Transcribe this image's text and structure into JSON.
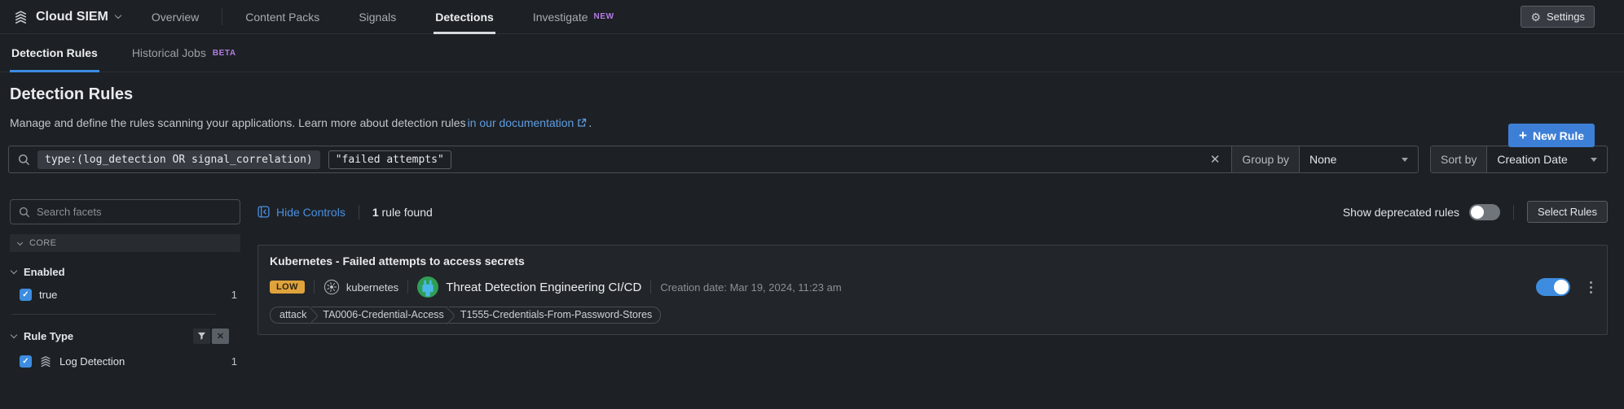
{
  "icons": {
    "settings_gear": "⚙",
    "clear_x": "✕",
    "checkbox_check": "✓",
    "plus": "+"
  },
  "top_nav": {
    "product": "Cloud SIEM",
    "items": [
      {
        "label": "Overview"
      },
      {
        "label": "Content Packs"
      },
      {
        "label": "Signals"
      },
      {
        "label": "Detections"
      },
      {
        "label": "Investigate",
        "badge": "NEW"
      }
    ],
    "settings_label": "Settings"
  },
  "tabs": {
    "detection_rules": "Detection Rules",
    "historical_jobs": "Historical Jobs",
    "historical_jobs_badge": "BETA"
  },
  "header": {
    "title": "Detection Rules",
    "description": "Manage and define the rules scanning your applications. Learn more about detection rules ",
    "doc_link": "in our documentation",
    "description_suffix": ".",
    "new_rule_label": "New Rule"
  },
  "search": {
    "filter_token": "type:(log_detection OR signal_correlation)",
    "query_token": "\"failed attempts\"",
    "group_by_label": "Group by",
    "group_by_value": "None",
    "sort_by_label": "Sort by",
    "sort_by_value": "Creation Date"
  },
  "facets": {
    "search_placeholder": "Search facets",
    "section_label": "CORE",
    "enabled_group": {
      "name": "Enabled",
      "option_label": "true",
      "option_count": "1",
      "checked": true
    },
    "rule_type_group": {
      "name": "Rule Type",
      "option_label": "Log Detection",
      "option_count": "1",
      "checked": true
    }
  },
  "controls": {
    "hide_controls_label": "Hide Controls",
    "result_count": "1",
    "result_count_suffix": " rule found",
    "show_deprecated_label": "Show deprecated rules",
    "deprecated_enabled": false,
    "select_rules_label": "Select Rules"
  },
  "rule": {
    "title": "Kubernetes - Failed attempts to access secrets",
    "severity": "LOW",
    "integration": "kubernetes",
    "author": "Threat Detection Engineering CI/CD",
    "creation_date": "Creation date: Mar 19, 2024, 11:23 am",
    "enabled": true,
    "tags": [
      "attack",
      "TA0006-Credential-Access",
      "T1555-Credentials-From-Password-Stores"
    ]
  },
  "colors": {
    "accent_blue": "#3d8ce0",
    "link_blue": "#5f9de2",
    "badge_purple": "#b57ce3",
    "severity_low_bg": "#e0a33c",
    "toggle_on": "#3d8ce0"
  }
}
